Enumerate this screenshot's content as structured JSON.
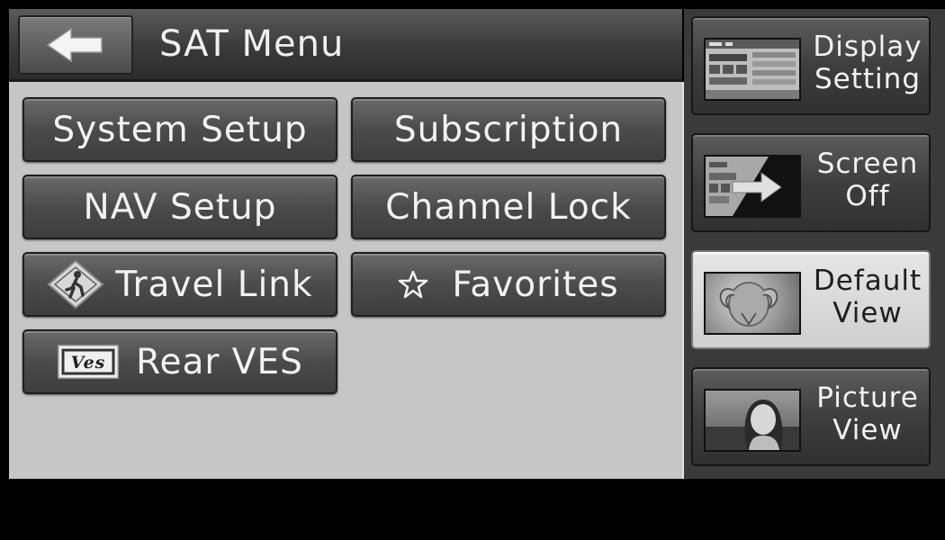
{
  "header": {
    "title": "SAT Menu",
    "back_icon": "back-arrow-icon"
  },
  "menu": {
    "system_setup": "System Setup",
    "subscription": "Subscription",
    "nav_setup": "NAV Setup",
    "channel_lock": "Channel Lock",
    "travel_link": "Travel Link",
    "favorites": "Favorites",
    "rear_ves": "Rear VES",
    "ves_logo_text": "Ves"
  },
  "side": {
    "display_setting": "Display Setting",
    "screen_off": "Screen Off",
    "default_view": "Default View",
    "picture_view": "Picture View",
    "selected": "default_view"
  },
  "colors": {
    "panel_bg": "#c6c6c6",
    "button_dark": "#4b4b4b",
    "selected_button": "#dcdcdc"
  }
}
